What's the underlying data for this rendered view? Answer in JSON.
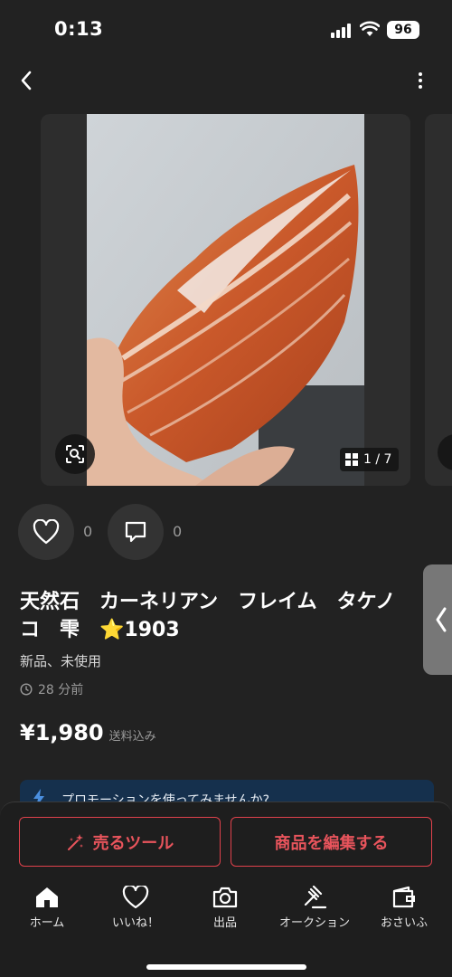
{
  "status": {
    "time": "0:13",
    "battery": "96"
  },
  "listing": {
    "title_line1": "天然石　カーネリアン　フレイム　タケノ",
    "title_line2": "コ　雫　⭐1903",
    "condition": "新品、未使用",
    "posted": "28 分前",
    "price": "¥1,980",
    "shipping": "送料込み",
    "likes": "0",
    "comments": "0"
  },
  "gallery": {
    "counter": "1 / 7"
  },
  "promo": {
    "text": "プロモーションを使ってみませんか?"
  },
  "actions": {
    "sell_tools": "売るツール",
    "edit_item": "商品を編集する"
  },
  "tabbar": {
    "home": "ホーム",
    "likes": "いいね！",
    "sell": "出品",
    "auction": "オークション",
    "wallet": "おさいふ"
  },
  "colors": {
    "accent": "#e8545c",
    "background": "#222222",
    "promo": "#15304d"
  },
  "icons": [
    "back-icon",
    "more-icon",
    "zoom-scan-icon",
    "grid-icon",
    "heart-icon",
    "comment-icon",
    "clock-icon",
    "sparkle-pen-icon",
    "home-icon",
    "camera-icon",
    "gavel-icon",
    "wallet-icon"
  ]
}
